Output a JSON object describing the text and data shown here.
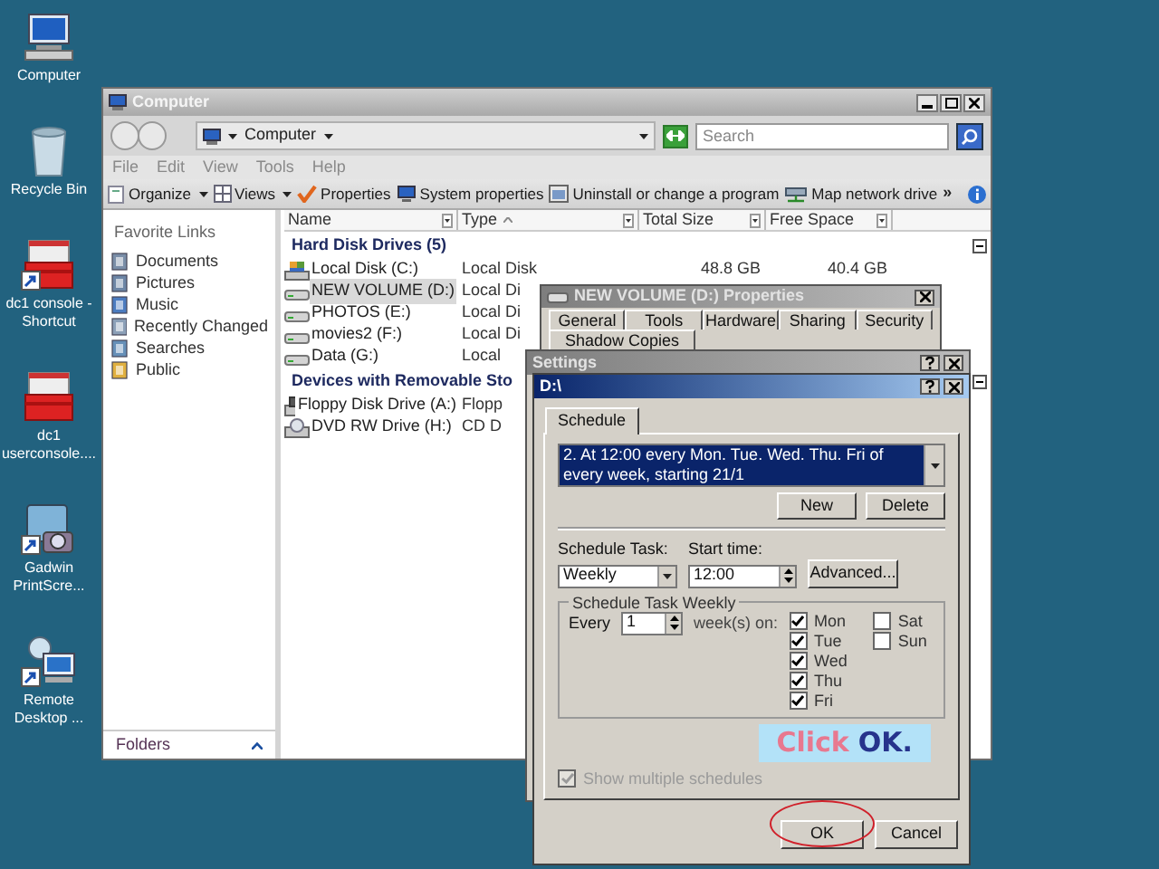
{
  "desktop_icons": [
    {
      "label": "Computer",
      "kind": "computer",
      "shortcut": false
    },
    {
      "label": "Recycle Bin",
      "kind": "recycle",
      "shortcut": false
    },
    {
      "label": "dc1 console - Shortcut",
      "kind": "toolbox",
      "shortcut": true
    },
    {
      "label": "dc1 userconsole....",
      "kind": "toolbox",
      "shortcut": false
    },
    {
      "label": "Gadwin PrintScre...",
      "kind": "camera",
      "shortcut": true
    },
    {
      "label": "Remote Desktop ...",
      "kind": "remote",
      "shortcut": true
    }
  ],
  "explorer": {
    "title": "Computer",
    "address": "Computer",
    "search_placeholder": "Search",
    "menu": [
      "File",
      "Edit",
      "View",
      "Tools",
      "Help"
    ],
    "toolbar": [
      {
        "label": "Organize",
        "kind": "organize",
        "dropdown": true
      },
      {
        "label": "Views",
        "kind": "views",
        "dropdown": true
      },
      {
        "label": "Properties",
        "kind": "properties",
        "dropdown": false
      },
      {
        "label": "System properties",
        "kind": "system",
        "dropdown": false
      },
      {
        "label": "Uninstall or change a program",
        "kind": "uninstall",
        "dropdown": false
      },
      {
        "label": "Map network drive",
        "kind": "network",
        "dropdown": false
      }
    ],
    "toolbar_overflow": "»",
    "favorites_title": "Favorite Links",
    "favorites": [
      {
        "label": "Documents",
        "kind": "documents"
      },
      {
        "label": "Pictures",
        "kind": "pictures"
      },
      {
        "label": "Music",
        "kind": "music"
      },
      {
        "label": "Recently Changed",
        "kind": "recent"
      },
      {
        "label": "Searches",
        "kind": "searches"
      },
      {
        "label": "Public",
        "kind": "public"
      }
    ],
    "folders_label": "Folders",
    "columns": [
      {
        "label": "Name",
        "sorted": false
      },
      {
        "label": "Type",
        "sorted": true
      },
      {
        "label": "Total Size",
        "sorted": false
      },
      {
        "label": "Free Space",
        "sorted": false
      }
    ],
    "groups": [
      {
        "title": "Hard Disk Drives (5)",
        "expanded": true,
        "items": [
          {
            "name": "Local Disk (C:)",
            "kind": "system",
            "selected": false,
            "type": "Local Disk",
            "total_size": "48.8 GB",
            "free_space": "40.4 GB"
          },
          {
            "name": "NEW VOLUME (D:)",
            "kind": "drive",
            "selected": true,
            "type": "Local Di"
          },
          {
            "name": "PHOTOS (E:)",
            "kind": "drive",
            "selected": false,
            "type": "Local Di"
          },
          {
            "name": "movies2 (F:)",
            "kind": "drive",
            "selected": false,
            "type": "Local Di"
          },
          {
            "name": "Data (G:)",
            "kind": "drive",
            "selected": false,
            "type": "Local"
          }
        ]
      },
      {
        "title": "Devices with Removable Sto",
        "expanded": true,
        "items": [
          {
            "name": "Floppy Disk Drive (A:)",
            "kind": "floppy",
            "selected": false,
            "type": "Flopp"
          },
          {
            "name": "DVD RW Drive (H:)",
            "kind": "dvd",
            "selected": false,
            "type": "CD D"
          }
        ]
      }
    ]
  },
  "properties": {
    "title": "NEW VOLUME (D:) Properties",
    "tabs_row1": [
      "General",
      "Tools",
      "Hardware",
      "Sharing",
      "Security"
    ],
    "tabs_row2": [
      "Shadow Copies"
    ]
  },
  "settings": {
    "title": "Settings"
  },
  "schedule": {
    "title": "D:\\",
    "tabs": [
      {
        "label": "Schedule",
        "selected": true
      }
    ],
    "schedule_list": "2. At 12:00 every Mon. Tue. Wed. Thu. Fri of every week, starting 21/1",
    "new": "New",
    "delete": "Delete",
    "task_label": "Schedule Task:",
    "task_value": "Weekly",
    "time_label": "Start time:",
    "time_value": "12:00",
    "advanced": "Advanced...",
    "group_title": "Schedule Task Weekly",
    "every_label": "Every",
    "every_value": "1",
    "weeks_label": "week(s) on:",
    "days": [
      {
        "label": "Mon",
        "checked": true
      },
      {
        "label": "Tue",
        "checked": true
      },
      {
        "label": "Wed",
        "checked": true
      },
      {
        "label": "Thu",
        "checked": true
      },
      {
        "label": "Fri",
        "checked": true
      },
      {
        "label": "Sat",
        "checked": false
      },
      {
        "label": "Sun",
        "checked": false
      }
    ],
    "show_multiple": {
      "label": "Show multiple schedules",
      "checked": true,
      "disabled": true
    },
    "buttons": [
      {
        "label": "OK",
        "highlighted": true
      },
      {
        "label": "Cancel",
        "highlighted": false
      }
    ]
  },
  "callout": {
    "action": "Click",
    "target": "OK."
  }
}
